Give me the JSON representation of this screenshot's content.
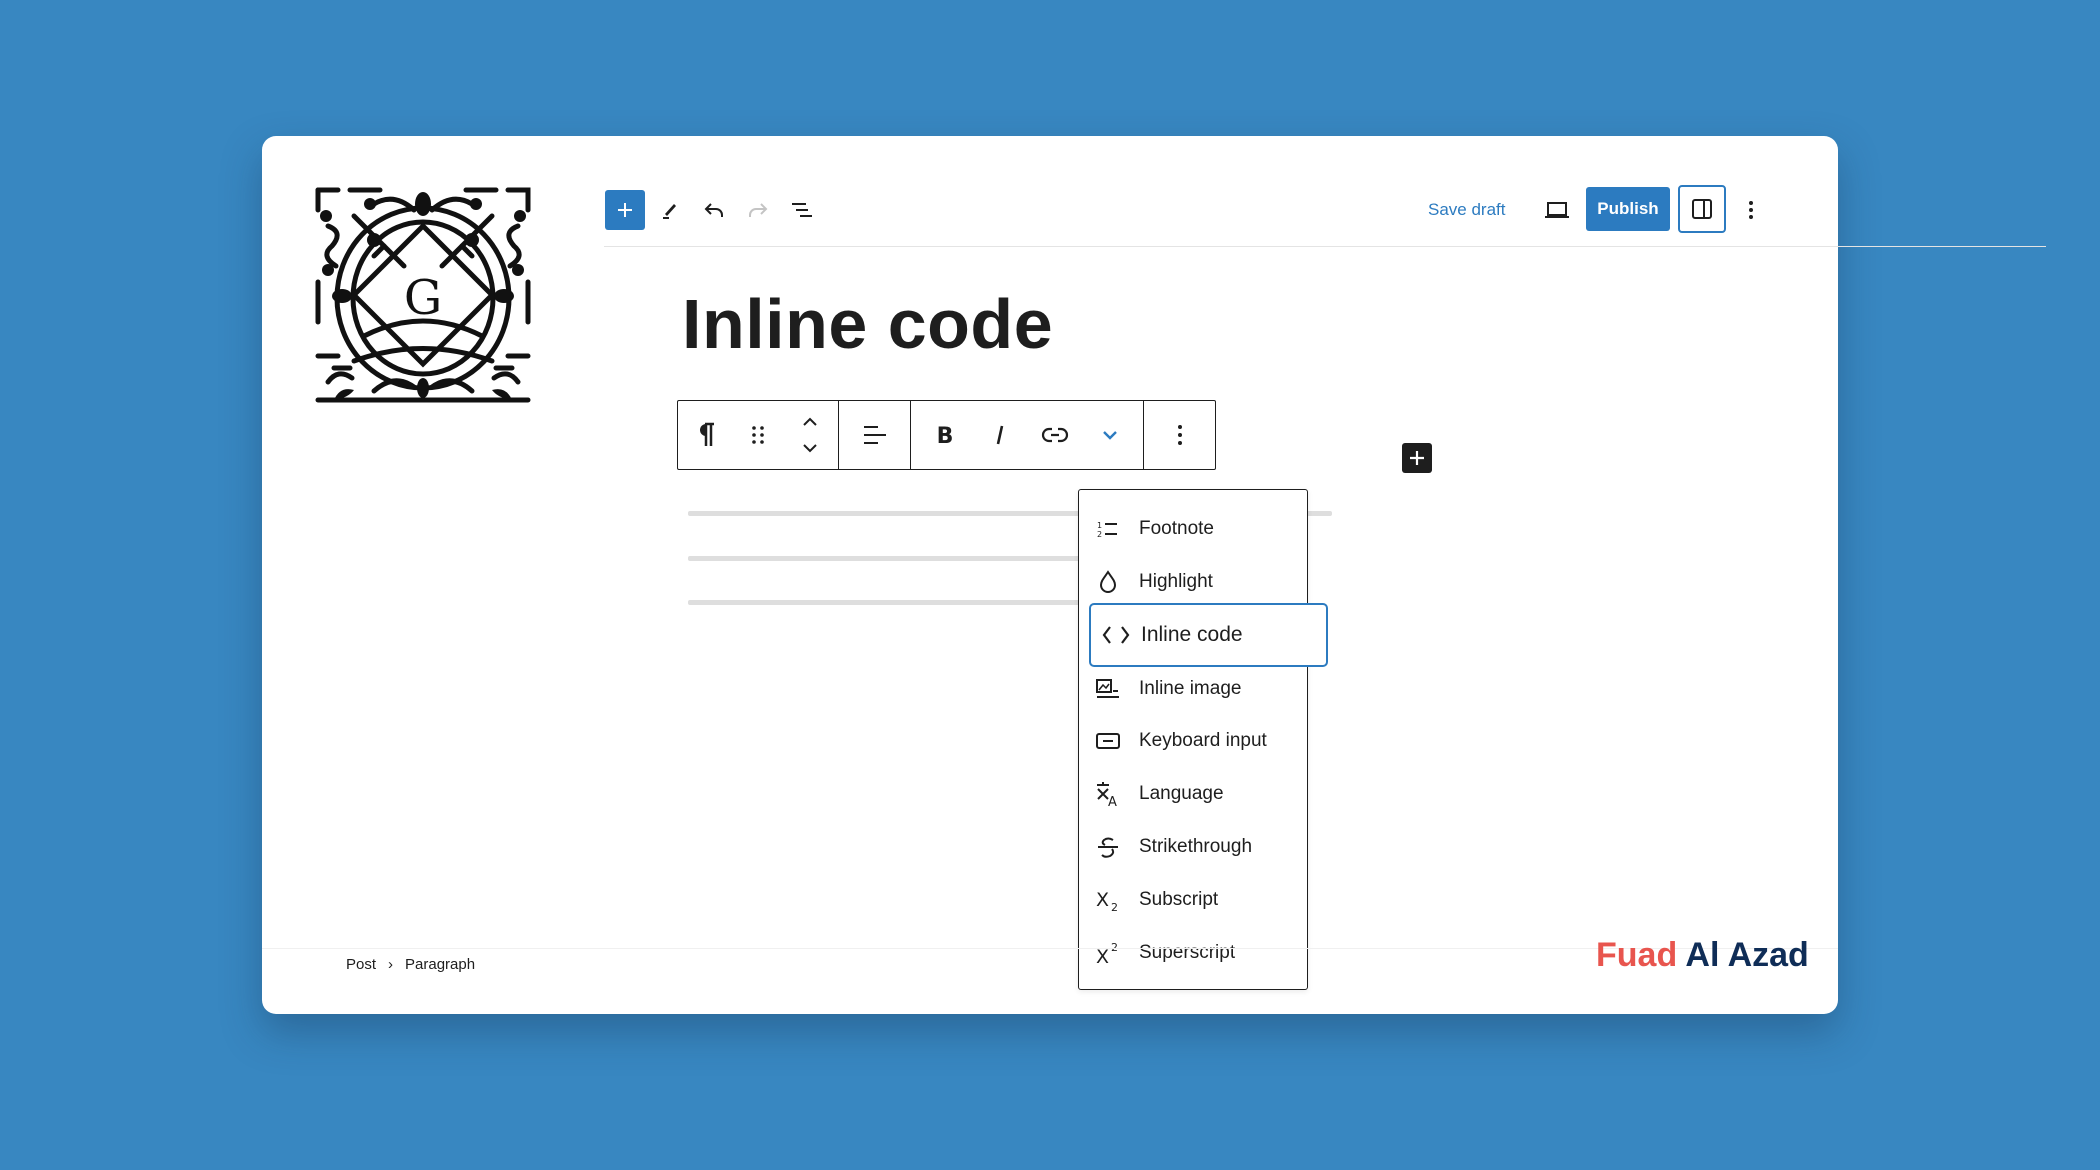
{
  "colors": {
    "background": "#3887c1",
    "accent": "#2c7bc0",
    "text": "#1e1e1e",
    "watermark_first": "#e8554e",
    "watermark_last": "#0f2d57"
  },
  "logo": {
    "icon": "wordpress-gutenberg-logo",
    "letter": "G"
  },
  "header": {
    "left_tools": [
      {
        "name": "block-inserter",
        "icon": "plus-icon"
      },
      {
        "name": "tools",
        "icon": "pencil-icon"
      },
      {
        "name": "undo",
        "icon": "undo-icon"
      },
      {
        "name": "redo",
        "icon": "redo-icon",
        "disabled": true
      },
      {
        "name": "document-overview",
        "icon": "list-view-icon"
      }
    ],
    "save_draft_label": "Save draft",
    "preview_icon": "desktop-icon",
    "publish_label": "Publish",
    "settings_icon": "sidebar-toggle-icon",
    "options_icon": "kebab-icon"
  },
  "post": {
    "title": "Inline code"
  },
  "block_toolbar": {
    "groups": [
      [
        "paragraph-icon",
        "drag-handle-icon",
        "move-up-down-icon"
      ],
      [
        "align-left-icon"
      ],
      [
        "bold-icon",
        "italic-icon",
        "link-icon",
        "more-formats-chevron-icon"
      ],
      [
        "block-options-kebab-icon"
      ]
    ]
  },
  "format_menu": {
    "items": [
      {
        "label": "Footnote",
        "icon": "footnote-icon"
      },
      {
        "label": "Highlight",
        "icon": "highlight-drop-icon"
      },
      {
        "label": "Inline code",
        "icon": "code-brackets-icon",
        "focused": true
      },
      {
        "label": "Inline image",
        "icon": "inline-image-icon"
      },
      {
        "label": "Keyboard input",
        "icon": "keyboard-icon"
      },
      {
        "label": "Language",
        "icon": "language-icon"
      },
      {
        "label": "Strikethrough",
        "icon": "strikethrough-icon"
      },
      {
        "label": "Subscript",
        "icon": "subscript-icon"
      },
      {
        "label": "Superscript",
        "icon": "superscript-icon"
      }
    ]
  },
  "breadcrumb": {
    "items": [
      "Post",
      "Paragraph"
    ],
    "separator": "›"
  },
  "watermark": {
    "first": "Fuad",
    "last": "Al Azad"
  }
}
